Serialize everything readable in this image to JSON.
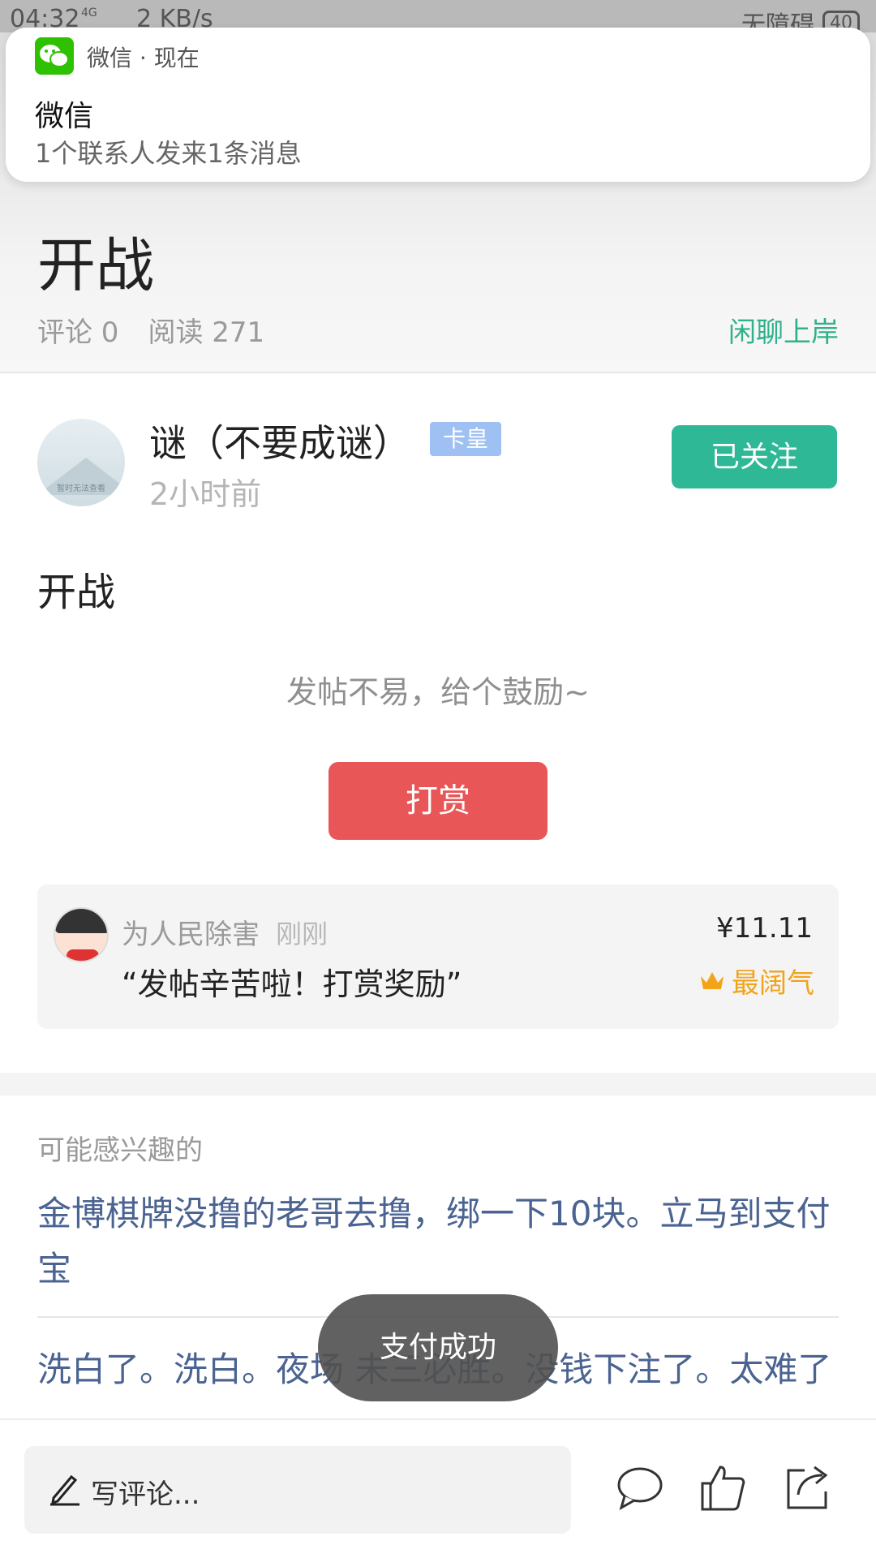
{
  "status_bar": {
    "time": "04:32",
    "network": "4G",
    "speed": "2 KB/s",
    "accessibility": "无障碍",
    "battery": "40"
  },
  "notification": {
    "app": "微信 · 现在",
    "title": "微信",
    "body": "1个联系人发来1条消息"
  },
  "post": {
    "title": "开战",
    "comments": "评论 0",
    "reads": "阅读 271",
    "forum": "闲聊上岸",
    "content": "开战"
  },
  "author": {
    "avatar_caption": "暂时无法查看",
    "name": "谜（不要成谜）",
    "badge": "卡皇",
    "time": "2小时前",
    "follow_label": "已关注"
  },
  "reward": {
    "encourage_text": "发帖不易，给个鼓励~",
    "button_label": "打赏",
    "record": {
      "user": "为人民除害",
      "time": "刚刚",
      "message": "“发帖辛苦啦！打赏奖励”",
      "amount": "¥11.11",
      "tag": "最阔气"
    }
  },
  "recommendations": {
    "heading": "可能感兴趣的",
    "items": [
      "金博棋牌没撸的老哥去撸，绑一下10块。立马到支付宝",
      "洗白了。洗白。夜场 未三必胜。没钱下注了。太难了"
    ]
  },
  "toast": "支付成功",
  "bottom_bar": {
    "comment_placeholder": "写评论..."
  },
  "colors": {
    "accent_green": "#2fb896",
    "reward_red": "#e85657",
    "link_blue": "#4a6391",
    "gold": "#f2a318"
  }
}
